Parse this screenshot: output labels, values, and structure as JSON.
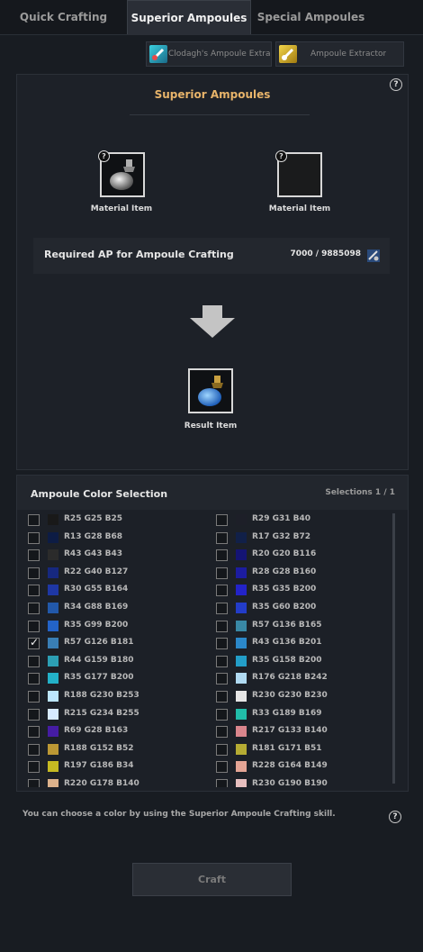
{
  "tabs": [
    {
      "label": "Quick Crafting",
      "active": false
    },
    {
      "label": "Superior Ampoules",
      "active": true
    },
    {
      "label": "Special Ampoules",
      "active": false
    }
  ],
  "extractors": [
    {
      "label": "Clodagh's Ampoule Extra",
      "icon": "clodagh-extractor-icon"
    },
    {
      "label": "Ampoule Extractor",
      "icon": "ampoule-extractor-icon"
    }
  ],
  "crafting": {
    "title": "Superior Ampoules",
    "help": "?",
    "material_1_label": "Material Item",
    "material_2_label": "Material Item",
    "slot_help": "?",
    "ap_label": "Required AP for Ampoule Crafting",
    "ap_value": "7000 / 9885098",
    "result_label": "Result Item"
  },
  "color_selection": {
    "title": "Ampoule Color Selection",
    "selections": "Selections 1 / 1",
    "left": [
      {
        "label": "R25 G25 B25",
        "color": "#191919",
        "checked": false
      },
      {
        "label": "R13 G28 B68",
        "color": "#0d1c44",
        "checked": false
      },
      {
        "label": "R43 G43 B43",
        "color": "#2b2b2b",
        "checked": false
      },
      {
        "label": "R22 G40 B127",
        "color": "#16287f",
        "checked": false
      },
      {
        "label": "R30 G55 B164",
        "color": "#1e37a4",
        "checked": false
      },
      {
        "label": "R34 G88 B169",
        "color": "#2258a9",
        "checked": false
      },
      {
        "label": "R35 G99 B200",
        "color": "#2363c8",
        "checked": false
      },
      {
        "label": "R57 G126 B181",
        "color": "#397eb5",
        "checked": true
      },
      {
        "label": "R44 G159 B180",
        "color": "#2c9fb4",
        "checked": false
      },
      {
        "label": "R35 G177 B200",
        "color": "#23b1c8",
        "checked": false
      },
      {
        "label": "R188 G230 B253",
        "color": "#bce6fd",
        "checked": false
      },
      {
        "label": "R215 G234 B255",
        "color": "#d7eaff",
        "checked": false
      },
      {
        "label": "R69 G28 B163",
        "color": "#451ca3",
        "checked": false
      },
      {
        "label": "R188 G152 B52",
        "color": "#bc9834",
        "checked": false
      },
      {
        "label": "R197 G186 B34",
        "color": "#c5ba22",
        "checked": false
      },
      {
        "label": "R220 G178 B140",
        "color": "#dcb28c",
        "checked": false
      }
    ],
    "right": [
      {
        "label": "R29 G31 B40",
        "color": "#1d1f28",
        "checked": false
      },
      {
        "label": "R17 G32 B72",
        "color": "#112048",
        "checked": false
      },
      {
        "label": "R20 G20 B116",
        "color": "#141474",
        "checked": false
      },
      {
        "label": "R28 G28 B160",
        "color": "#1c1ca0",
        "checked": false
      },
      {
        "label": "R35 G35 B200",
        "color": "#2323c8",
        "checked": false
      },
      {
        "label": "R35 G60 B200",
        "color": "#233cc8",
        "checked": false
      },
      {
        "label": "R57 G136 B165",
        "color": "#3988a5",
        "checked": false
      },
      {
        "label": "R43 G136 B201",
        "color": "#2b88c9",
        "checked": false
      },
      {
        "label": "R35 G158 B200",
        "color": "#239ec8",
        "checked": false
      },
      {
        "label": "R176 G218 B242",
        "color": "#b0daf2",
        "checked": false
      },
      {
        "label": "R230 G230 B230",
        "color": "#e6e6e6",
        "checked": false
      },
      {
        "label": "R33 G189 B169",
        "color": "#21bda9",
        "checked": false
      },
      {
        "label": "R217 G133 B140",
        "color": "#d9858c",
        "checked": false
      },
      {
        "label": "R181 G171 B51",
        "color": "#b5ab33",
        "checked": false
      },
      {
        "label": "R228 G164 B149",
        "color": "#e4a495",
        "checked": false
      },
      {
        "label": "R230 G190 B190",
        "color": "#e6bebe",
        "checked": false
      }
    ]
  },
  "hint": "You can choose a color by using the Superior Ampoule Crafting skill.",
  "craft_label": "Craft"
}
